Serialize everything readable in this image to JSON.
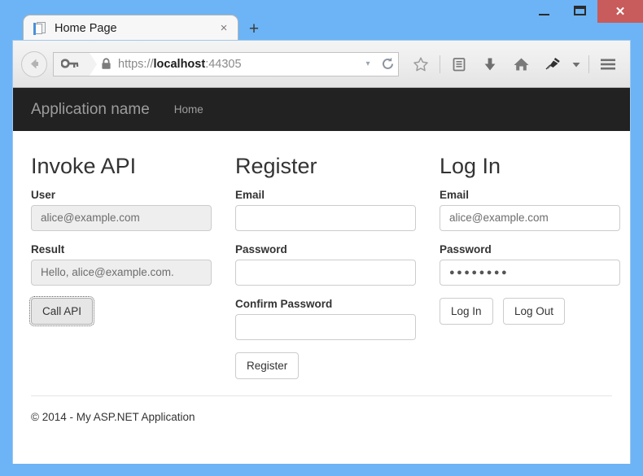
{
  "window": {
    "controls": {
      "minimize": "minimize",
      "maximize": "maximize",
      "close": "✕"
    }
  },
  "browser": {
    "tab": {
      "title": "Home Page",
      "close_glyph": "×",
      "favicon": "page-icon"
    },
    "new_tab_glyph": "+",
    "address_bar": {
      "url_scheme": "https://",
      "url_host": "localhost",
      "url_port": ":44305",
      "full_url": "https://localhost:44305",
      "identity_icon": "key-icon",
      "security_icon": "lock-icon",
      "dropdown_glyph": "▾",
      "reload_icon": "reload-icon"
    },
    "toolbar_icons": [
      "bookmark-star-icon",
      "reading-list-icon",
      "download-icon",
      "home-icon",
      "pin-icon",
      "overflow-caret-icon",
      "menu-hamburger-icon"
    ],
    "back_icon": "back-arrow-icon"
  },
  "site": {
    "navbar": {
      "brand": "Application name",
      "links": [
        {
          "label": "Home"
        }
      ]
    },
    "columns": [
      {
        "heading": "Invoke API",
        "fields": [
          {
            "label": "User",
            "value": "alice@example.com",
            "placeholder": "",
            "disabled": true,
            "type": "text"
          },
          {
            "label": "Result",
            "value": "Hello, alice@example.com.",
            "placeholder": "",
            "disabled": true,
            "type": "text"
          }
        ],
        "buttons": [
          {
            "label": "Call API",
            "focused": true
          }
        ]
      },
      {
        "heading": "Register",
        "fields": [
          {
            "label": "Email",
            "value": "",
            "placeholder": "",
            "disabled": false,
            "type": "text"
          },
          {
            "label": "Password",
            "value": "",
            "placeholder": "",
            "disabled": false,
            "type": "password"
          },
          {
            "label": "Confirm Password",
            "value": "",
            "placeholder": "",
            "disabled": false,
            "type": "password"
          }
        ],
        "buttons": [
          {
            "label": "Register",
            "focused": false
          }
        ]
      },
      {
        "heading": "Log In",
        "fields": [
          {
            "label": "Email",
            "value": "alice@example.com",
            "placeholder": "",
            "disabled": false,
            "type": "text"
          },
          {
            "label": "Password",
            "value": "●●●●●●●●",
            "placeholder": "",
            "disabled": false,
            "type": "password"
          }
        ],
        "buttons": [
          {
            "label": "Log In",
            "focused": false
          },
          {
            "label": "Log Out",
            "focused": false
          }
        ]
      }
    ],
    "footer": {
      "copyright": "© 2014 - My ASP.NET Application"
    }
  },
  "colors": {
    "window_frame": "#6cb4f5",
    "close_button": "#c85b5b",
    "navbar_bg": "#222222",
    "navbar_text": "#9d9d9d",
    "input_border": "#cccccc",
    "input_disabled_bg": "#eeeeee",
    "heading_text": "#333333"
  }
}
